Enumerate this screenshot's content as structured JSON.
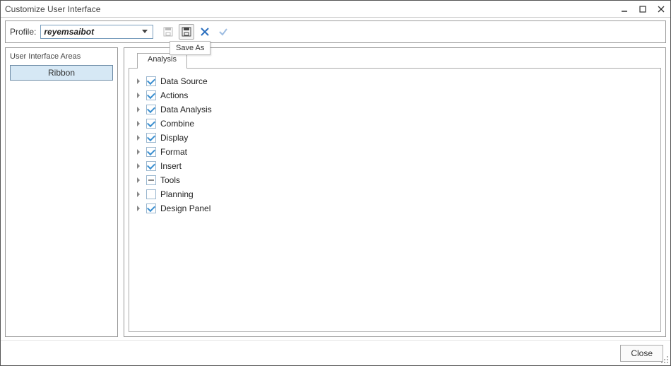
{
  "window": {
    "title": "Customize User Interface"
  },
  "profile": {
    "label": "Profile:",
    "value": "reyemsaibot"
  },
  "tooltip": {
    "save_as": "Save As"
  },
  "left": {
    "group_title": "User Interface Areas",
    "ribbon_label": "Ribbon"
  },
  "tabs": {
    "analysis": "Analysis"
  },
  "tree": [
    {
      "label": "Data Source",
      "state": "checked"
    },
    {
      "label": "Actions",
      "state": "checked"
    },
    {
      "label": "Data Analysis",
      "state": "checked"
    },
    {
      "label": "Combine",
      "state": "checked"
    },
    {
      "label": "Display",
      "state": "checked"
    },
    {
      "label": "Format",
      "state": "checked"
    },
    {
      "label": "Insert",
      "state": "checked"
    },
    {
      "label": "Tools",
      "state": "indeterminate"
    },
    {
      "label": "Planning",
      "state": "unchecked"
    },
    {
      "label": "Design Panel",
      "state": "checked"
    }
  ],
  "footer": {
    "close": "Close"
  }
}
